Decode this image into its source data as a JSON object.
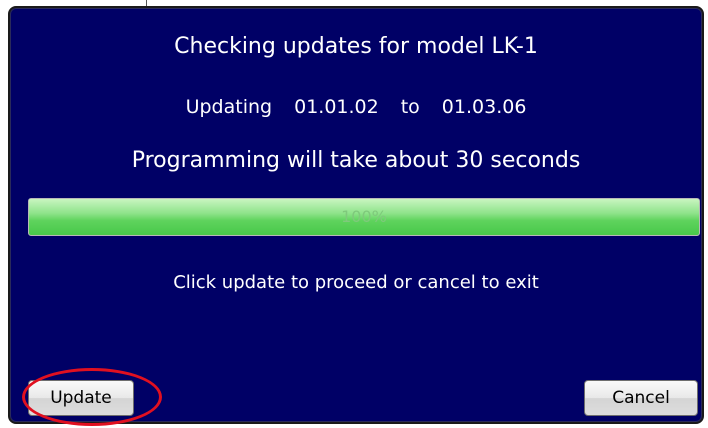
{
  "dialog": {
    "title": "Checking updates for model LK-1",
    "version": {
      "prefix": "Updating",
      "from": "01.01.02",
      "connector": "to",
      "to": "01.03.06"
    },
    "duration_text": "Programming  will take about 30 seconds",
    "progress": {
      "percent": 100,
      "label": "100%"
    },
    "instruction": "Click update to proceed or cancel to exit",
    "buttons": {
      "update_label": "Update",
      "cancel_label": "Cancel"
    }
  },
  "colors": {
    "dialog_background": "#000066",
    "text": "#ffffff",
    "progress_fill": "#5fd35d",
    "highlight": "#e01020"
  }
}
